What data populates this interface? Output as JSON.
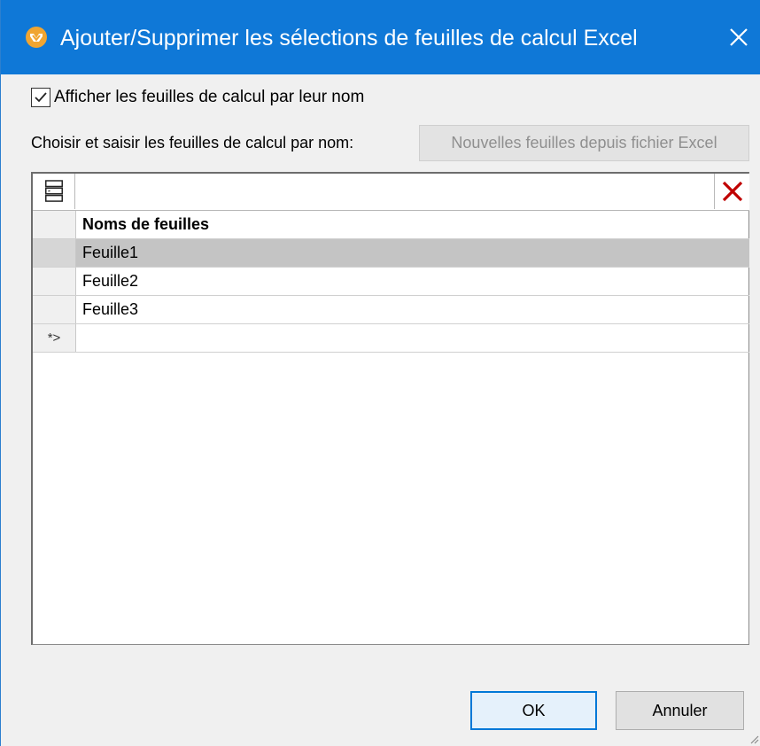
{
  "window": {
    "title": "Ajouter/Supprimer les sélections de feuilles de calcul Excel",
    "icon": "mapforce-app-icon",
    "close_icon": "close-icon"
  },
  "options": {
    "show_by_name_label": "Afficher les feuilles de calcul par leur nom",
    "show_by_name_checked": true,
    "choose_label": "Choisir et saisir les feuilles de calcul par nom:",
    "new_sheets_button": "Nouvelles feuilles depuis fichier Excel"
  },
  "grid": {
    "toolbar": {
      "left_icon": "insert-row-icon",
      "right_icon": "delete-icon"
    },
    "column_header": "Noms de feuilles",
    "rows": [
      {
        "name": "Feuille1",
        "selected": true
      },
      {
        "name": "Feuille2",
        "selected": false
      },
      {
        "name": "Feuille3",
        "selected": false
      }
    ],
    "new_row_marker": "*>"
  },
  "buttons": {
    "ok": "OK",
    "cancel": "Annuler"
  },
  "colors": {
    "titlebar": "#0f78d7",
    "selected_row": "#c4c4c4",
    "delete_icon": "#c00000",
    "app_icon": "#f0a531"
  }
}
